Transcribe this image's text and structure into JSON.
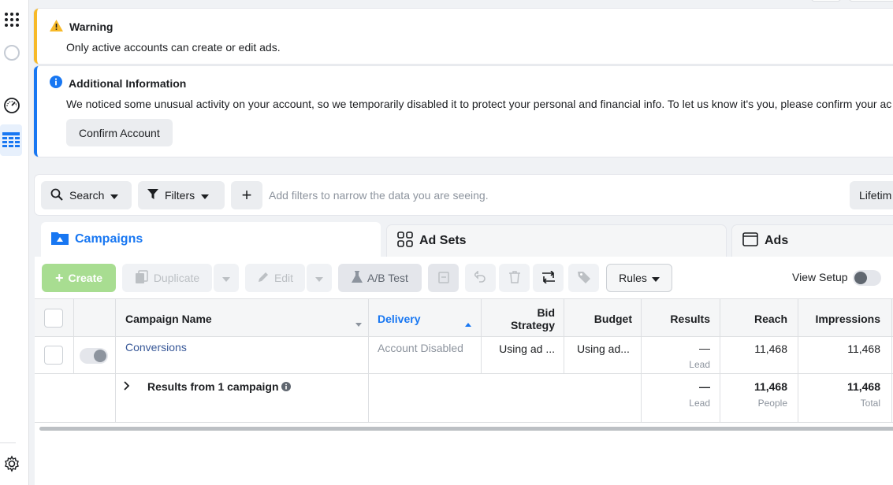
{
  "alerts": {
    "warning": {
      "title": "Warning",
      "message": "Only active accounts can create or edit ads."
    },
    "info": {
      "title": "Additional Information",
      "message": "We noticed some unusual activity on your account, so we temporarily disabled it to protect your personal and financial info. To let us know it's you, please confirm your ac",
      "button": "Confirm Account"
    }
  },
  "filterbar": {
    "search": "Search",
    "filters": "Filters",
    "add": "+",
    "placeholder": "Add filters to narrow the data you are seeing.",
    "date": "Lifetim"
  },
  "tabs": {
    "campaigns": "Campaigns",
    "adsets": "Ad Sets",
    "ads": "Ads"
  },
  "toolbar": {
    "create": "Create",
    "duplicate": "Duplicate",
    "edit": "Edit",
    "ab_test": "A/B Test",
    "rules": "Rules",
    "view_setup": "View Setup"
  },
  "table": {
    "headers": {
      "name": "Campaign Name",
      "delivery": "Delivery",
      "bid_1": "Bid",
      "bid_2": "Strategy",
      "budget": "Budget",
      "results": "Results",
      "reach": "Reach",
      "impressions": "Impressions"
    },
    "row": {
      "name": "Conversions",
      "delivery": "Account Disabled",
      "bid": "Using ad ...",
      "budget": "Using ad...",
      "results": "—",
      "results_sub": "Lead",
      "reach": "11,468",
      "impressions": "11,468"
    },
    "summary": {
      "label": "Results from 1 campaign",
      "results": "—",
      "results_sub": "Lead",
      "reach": "11,468",
      "reach_sub": "People",
      "impressions": "11,468",
      "impressions_sub": "Total"
    }
  },
  "colors": {
    "accent": "#1877f2",
    "warning": "#f7b928",
    "create_green": "#a8dd91"
  }
}
